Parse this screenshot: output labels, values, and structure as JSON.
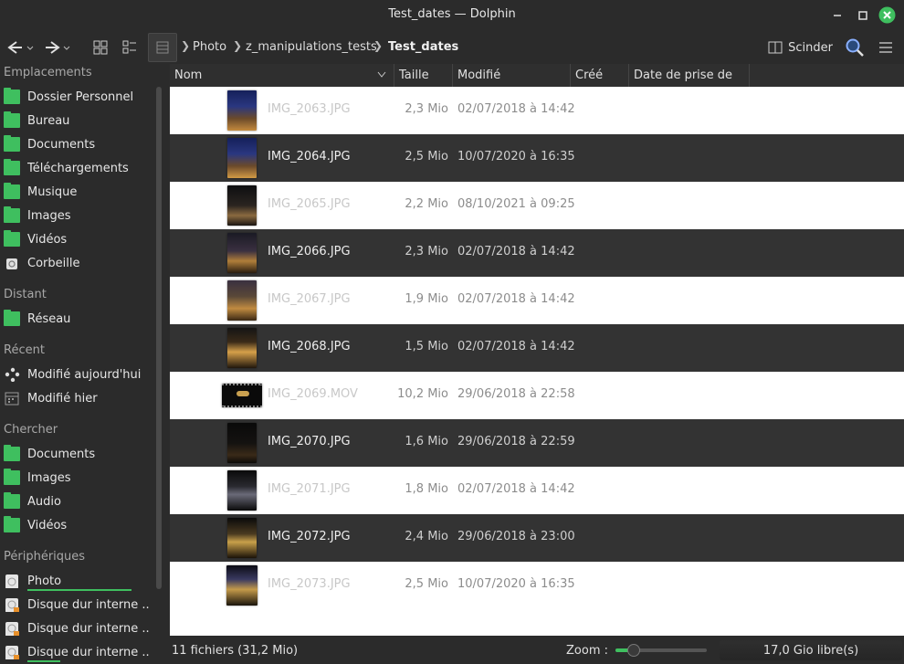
{
  "window": {
    "title": "Test_dates — Dolphin"
  },
  "toolbar": {
    "breadcrumbs": [
      "Photo",
      "z_manipulations_tests",
      "Test_dates"
    ],
    "split_label": "Scinder"
  },
  "sidebar": {
    "sections": {
      "places": "Emplacements",
      "remote": "Distant",
      "recent": "Récent",
      "search": "Chercher",
      "devices": "Périphériques"
    },
    "places": [
      "Dossier Personnel",
      "Bureau",
      "Documents",
      "Téléchargements",
      "Musique",
      "Images",
      "Vidéos",
      "Corbeille"
    ],
    "remote": [
      "Réseau"
    ],
    "recent": [
      "Modifié aujourd'hui",
      "Modifié hier"
    ],
    "search": [
      "Documents",
      "Images",
      "Audio",
      "Vidéos"
    ],
    "devices": [
      "Photo",
      "Disque dur interne ...",
      "Disque dur interne ...",
      "Disque dur interne ..."
    ]
  },
  "columns": [
    "Nom",
    "Taille",
    "Modifié",
    "Créé",
    "Date de prise de vue"
  ],
  "files": [
    {
      "name": "IMG_2063.JPG",
      "size": "2,3 Mio",
      "modified": "02/07/2018 à 14:42"
    },
    {
      "name": "IMG_2064.JPG",
      "size": "2,5 Mio",
      "modified": "10/07/2020 à 16:35"
    },
    {
      "name": "IMG_2065.JPG",
      "size": "2,2 Mio",
      "modified": "08/10/2021 à 09:25"
    },
    {
      "name": "IMG_2066.JPG",
      "size": "2,3 Mio",
      "modified": "02/07/2018 à 14:42"
    },
    {
      "name": "IMG_2067.JPG",
      "size": "1,9 Mio",
      "modified": "02/07/2018 à 14:42"
    },
    {
      "name": "IMG_2068.JPG",
      "size": "1,5 Mio",
      "modified": "02/07/2018 à 14:42"
    },
    {
      "name": "IMG_2069.MOV",
      "size": "10,2 Mio",
      "modified": "29/06/2018 à 22:58"
    },
    {
      "name": "IMG_2070.JPG",
      "size": "1,6 Mio",
      "modified": "29/06/2018 à 22:59"
    },
    {
      "name": "IMG_2071.JPG",
      "size": "1,8 Mio",
      "modified": "02/07/2018 à 14:42"
    },
    {
      "name": "IMG_2072.JPG",
      "size": "2,4 Mio",
      "modified": "29/06/2018 à 23:00"
    },
    {
      "name": "IMG_2073.JPG",
      "size": "2,5 Mio",
      "modified": "10/07/2020 à 16:35"
    }
  ],
  "status": {
    "summary": "11 fichiers (31,2 Mio)",
    "zoom_label": "Zoom :",
    "zoom_level": 0.2,
    "free_space": "17,0 Gio libre(s)"
  },
  "colors": {
    "accent": "#3fbf5f",
    "row_dark": "#333333",
    "row_light": "#ffffff",
    "window_bg": "#2b2b2b"
  }
}
